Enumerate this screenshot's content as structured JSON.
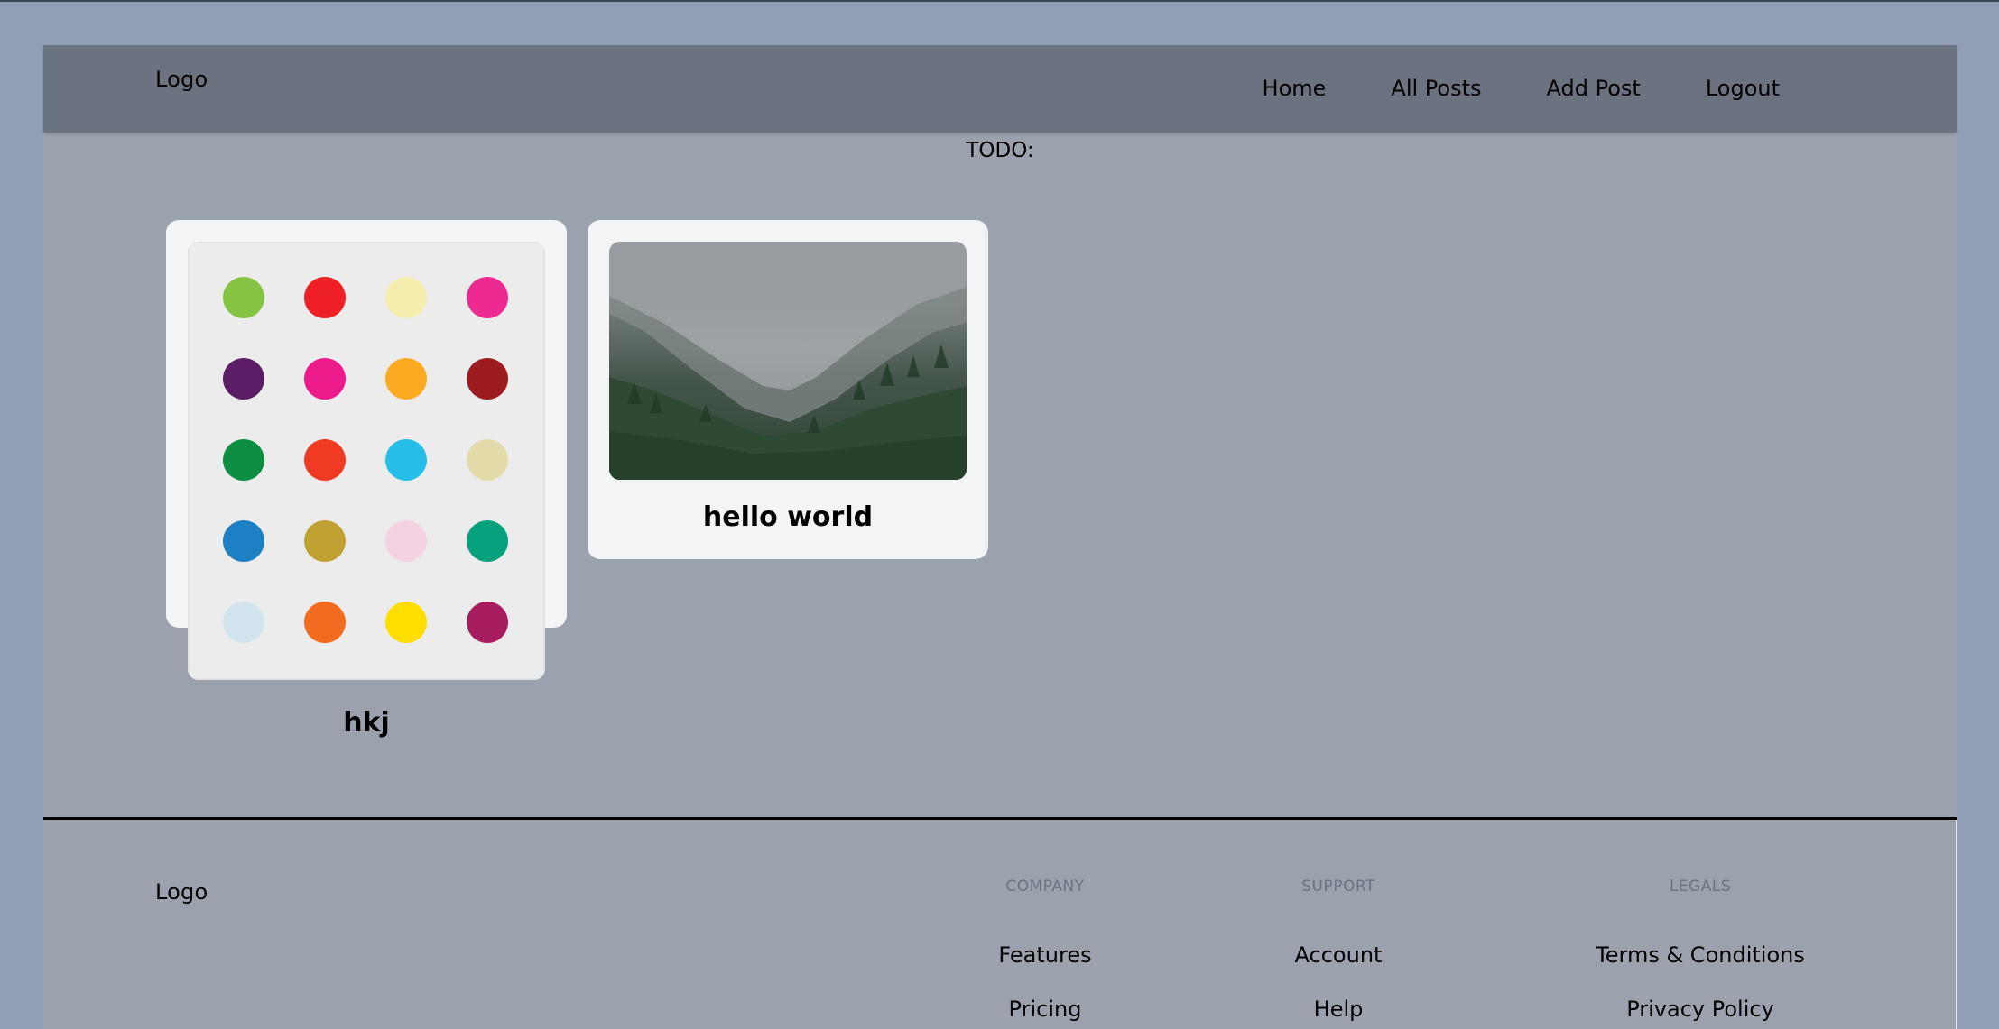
{
  "header": {
    "logo": "Logo",
    "nav": [
      "Home",
      "All Posts",
      "Add Post",
      "Logout"
    ]
  },
  "todo": "TODO:",
  "posts": [
    {
      "title": "hkj",
      "image": "colored-dots-painting"
    },
    {
      "title": "hello world",
      "image": "misty-forest-valley"
    }
  ],
  "footer": {
    "logo": "Logo",
    "company": {
      "heading": "COMPANY",
      "links": [
        "Features",
        "Pricing"
      ]
    },
    "support": {
      "heading": "SUPPORT",
      "links": [
        "Account",
        "Help"
      ]
    },
    "legals": {
      "heading": "LEGALS",
      "links": [
        "Terms & Conditions",
        "Privacy Policy"
      ]
    }
  },
  "dot_colors": [
    "#86c443",
    "#ee2026",
    "#f5eeaf",
    "#ec2a91",
    "#5b1e66",
    "#ec1b8c",
    "#fbaa22",
    "#9d1c1f",
    "#0c8f43",
    "#ef3a24",
    "#27bde9",
    "#e3dba9",
    "#1e80c4",
    "#c0a232",
    "#f3d2e1",
    "#05a07c",
    "#d2e5ee",
    "#f36a21",
    "#fede00",
    "#a71c5e"
  ]
}
